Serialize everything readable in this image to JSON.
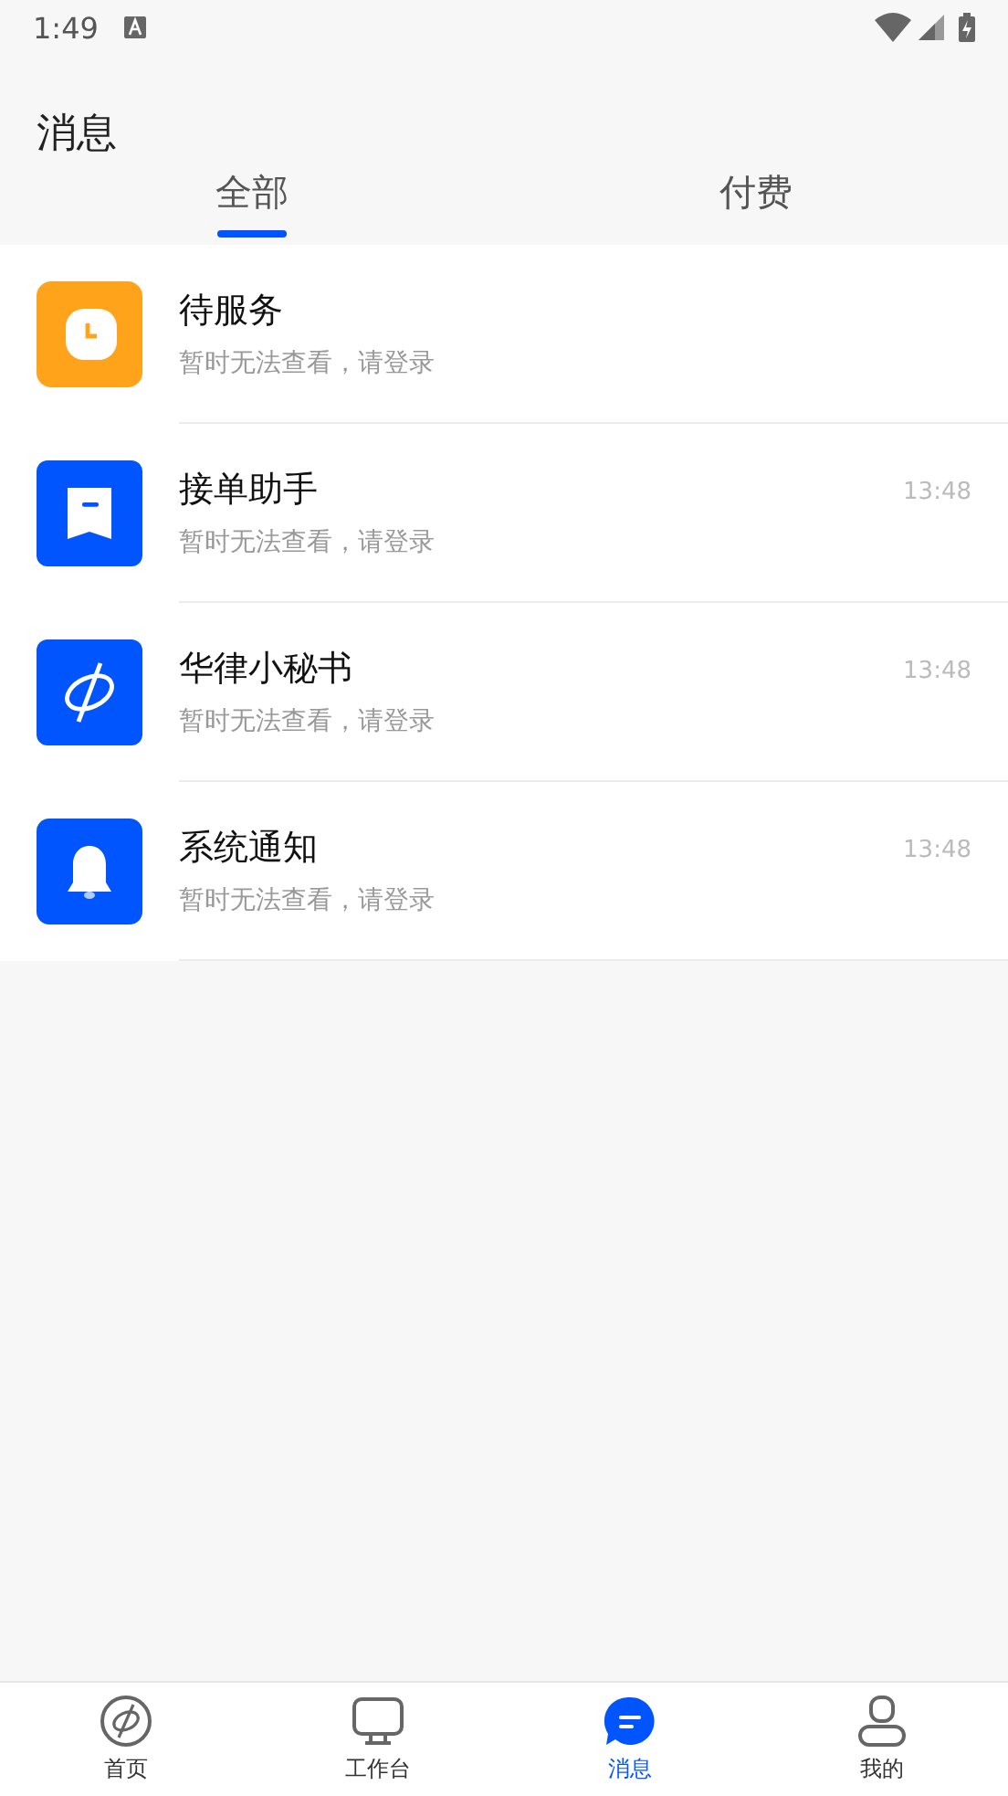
{
  "status_bar": {
    "time": "1:49"
  },
  "header": {
    "title": "消息"
  },
  "tabs": [
    {
      "label": "全部",
      "selected": true
    },
    {
      "label": "付费",
      "selected": false
    }
  ],
  "messages": [
    {
      "kind": "clock",
      "color": "#ffa31a",
      "title": "待服务",
      "preview": "暂时无法查看，请登录"
    },
    {
      "kind": "bookmark",
      "color": "#0055ff",
      "title": "接单助手",
      "preview": "暂时无法查看，请登录",
      "time": "13:48"
    },
    {
      "kind": "logo",
      "color": "#0055ff",
      "title": "华律小秘书",
      "preview": "暂时无法查看，请登录",
      "time": "13:48"
    },
    {
      "kind": "bell",
      "color": "#0055ff",
      "title": "系统通知",
      "preview": "暂时无法查看，请登录",
      "time": "13:48"
    }
  ],
  "bottom_nav": [
    {
      "kind": "home",
      "label": "首页",
      "selected": false
    },
    {
      "kind": "workbench",
      "label": "工作台",
      "selected": false
    },
    {
      "kind": "messages",
      "label": "消息",
      "selected": true
    },
    {
      "kind": "profile",
      "label": "我的",
      "selected": false
    }
  ]
}
